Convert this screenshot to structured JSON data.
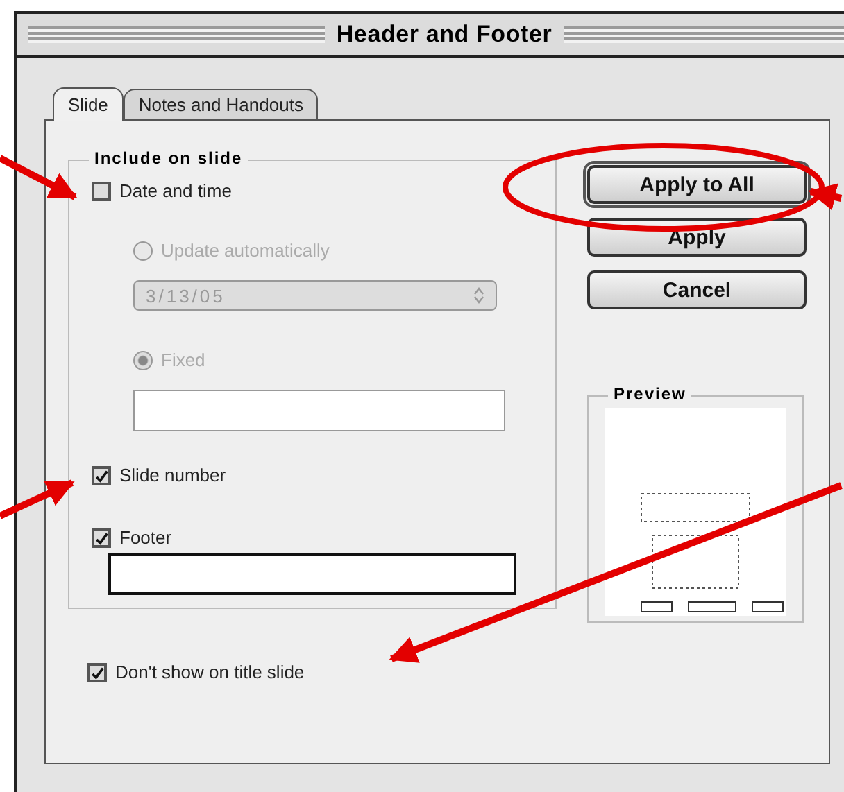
{
  "window": {
    "title": "Header and Footer"
  },
  "tabs": [
    {
      "label": "Slide",
      "selected": true
    },
    {
      "label": "Notes and Handouts",
      "selected": false
    }
  ],
  "include_group": {
    "title": "Include on slide",
    "date_time": {
      "label": "Date and time",
      "checked": false,
      "options": [
        {
          "kind": "auto",
          "label": "Update automatically",
          "selected": false,
          "date": "3/13/05"
        },
        {
          "kind": "fixed",
          "label": "Fixed",
          "selected": true
        }
      ]
    },
    "slide_number": {
      "label": "Slide number",
      "checked": true
    },
    "footer": {
      "label": "Footer",
      "checked": true
    }
  },
  "title_slide": {
    "label": "Don't show on title slide",
    "checked": true
  },
  "buttons": [
    {
      "label": "Apply to All",
      "default": true
    },
    {
      "label": "Apply",
      "default": false
    },
    {
      "label": "Cancel",
      "default": false
    }
  ],
  "preview": {
    "title": "Preview"
  }
}
